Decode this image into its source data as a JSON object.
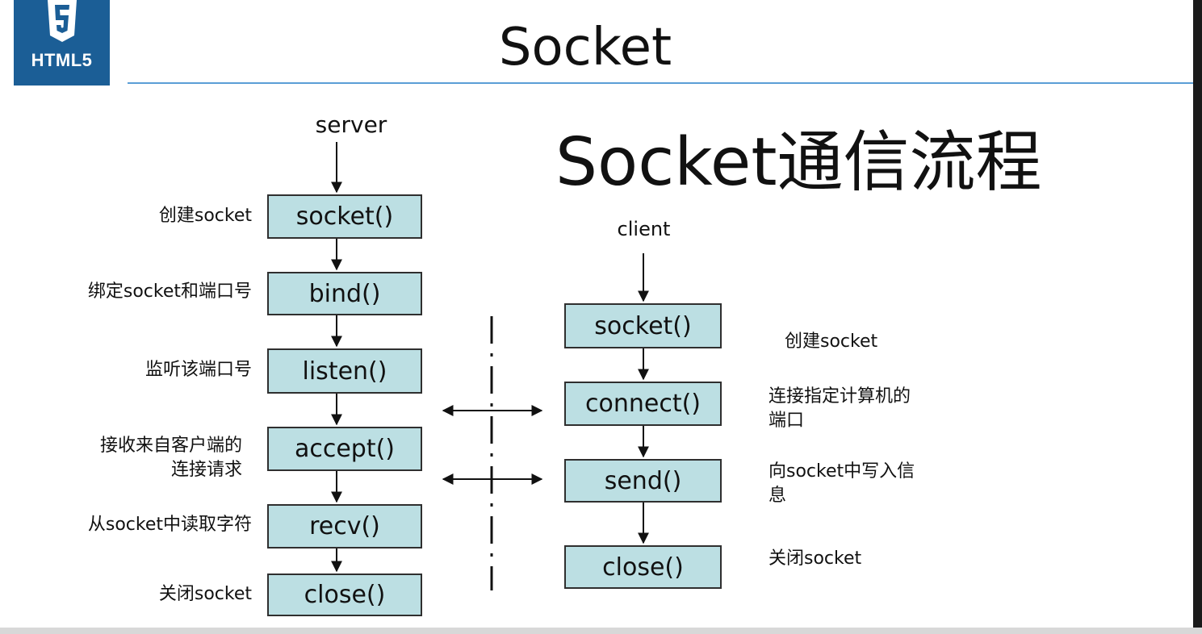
{
  "logo": {
    "text": "HTML5",
    "icon": "html5-shield-icon"
  },
  "title": "Socket",
  "heading": "Socket通信流程",
  "server": {
    "label": "server",
    "steps": [
      {
        "call": "socket()",
        "note": "创建socket"
      },
      {
        "call": "bind()",
        "note": "绑定socket和端口号"
      },
      {
        "call": "listen()",
        "note": "监听该端口号"
      },
      {
        "call": "accept()",
        "note": "接收来自客户端的\n连接请求"
      },
      {
        "call": "recv()",
        "note": "从socket中读取字符"
      },
      {
        "call": "close()",
        "note": "关闭socket"
      }
    ]
  },
  "client": {
    "label": "client",
    "steps": [
      {
        "call": "socket()",
        "note": "创建socket"
      },
      {
        "call": "connect()",
        "note": "连接指定计算机的\n端口"
      },
      {
        "call": "send()",
        "note": "向socket中写入信\n息"
      },
      {
        "call": "close()",
        "note": "关闭socket"
      }
    ]
  },
  "colors": {
    "box_fill": "#bcdfe3",
    "rule": "#5a9ed6",
    "logo_bg": "#1b5e96"
  }
}
